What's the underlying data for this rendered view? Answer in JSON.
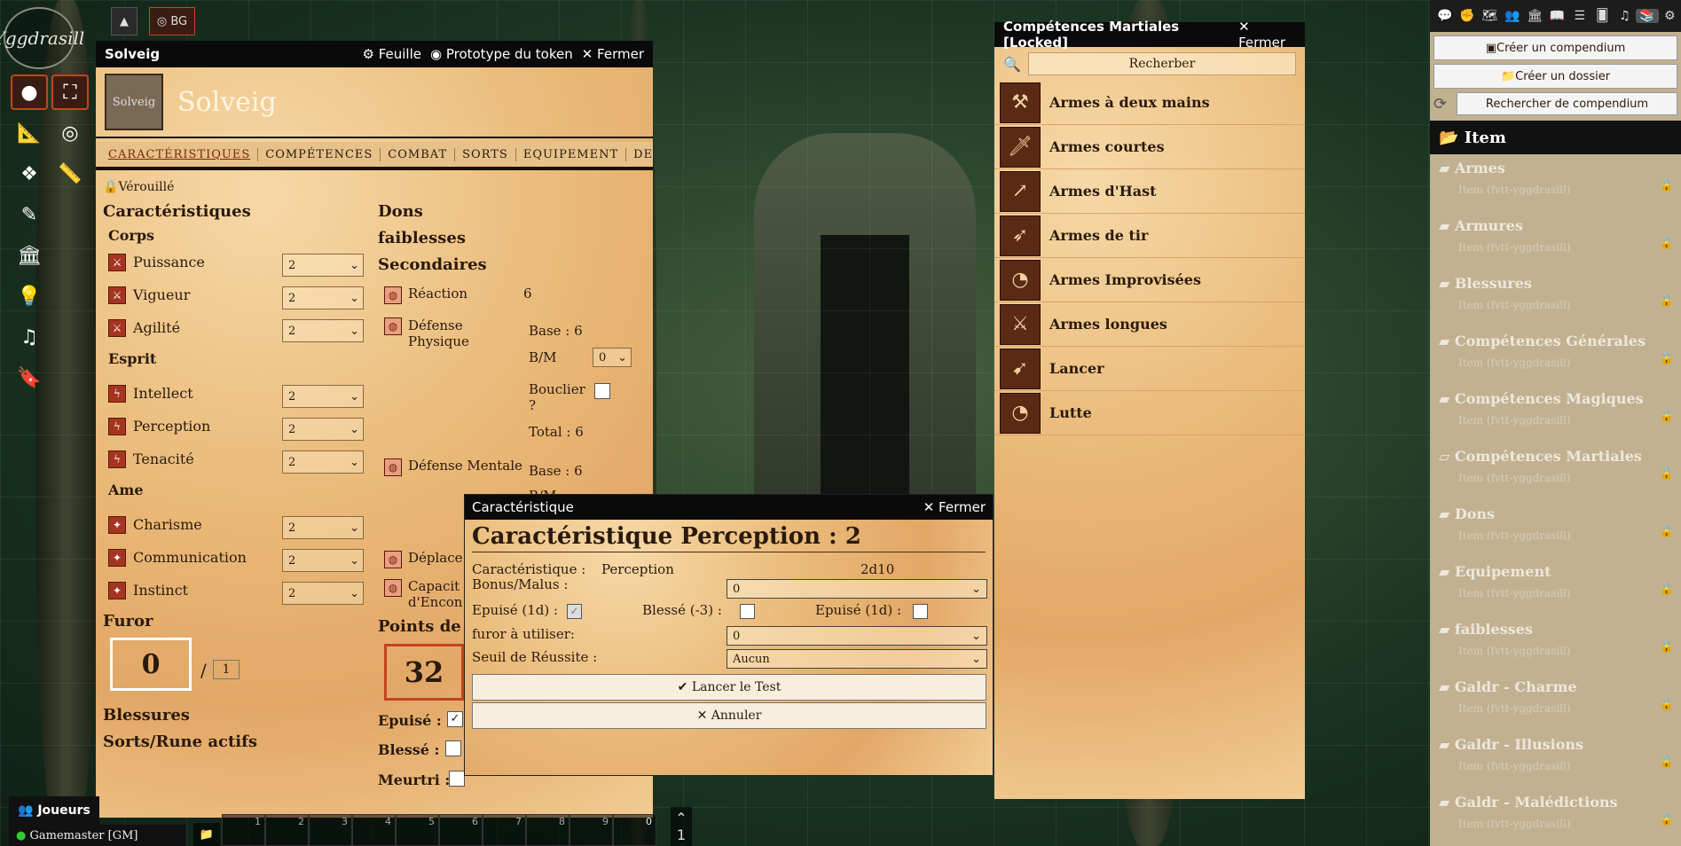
{
  "app": {
    "logo": "Yggdrasill",
    "bg_button": "BG"
  },
  "sheet": {
    "title": "Solveig",
    "actions": {
      "sheet": "Feuille",
      "token": "Prototype du token",
      "close": "Fermer"
    },
    "avatar_label": "Solveig",
    "name": "Solveig",
    "tabs": [
      "CARACTÉRISTIQUES",
      "COMPÉTENCES",
      "COMBAT",
      "SORTS",
      "EQUIPEMENT",
      "DESCRIPTION"
    ],
    "locked": "Vérouillé",
    "caracteristiques": "Caractéristiques",
    "corps": "Corps",
    "esprit": "Esprit",
    "ame": "Ame",
    "stats": {
      "puissance": {
        "label": "Puissance",
        "value": "2"
      },
      "vigueur": {
        "label": "Vigueur",
        "value": "2"
      },
      "agilite": {
        "label": "Agilité",
        "value": "2"
      },
      "intellect": {
        "label": "Intellect",
        "value": "2"
      },
      "perception": {
        "label": "Perception",
        "value": "2"
      },
      "tenacite": {
        "label": "Tenacité",
        "value": "2"
      },
      "charisme": {
        "label": "Charisme",
        "value": "2"
      },
      "communication": {
        "label": "Communication",
        "value": "2"
      },
      "instinct": {
        "label": "Instinct",
        "value": "2"
      }
    },
    "furor": {
      "label": "Furor",
      "value": "0",
      "separator": "/",
      "max": "1"
    },
    "blessures": "Blessures",
    "sorts_actifs": "Sorts/Rune actifs",
    "dons": "Dons",
    "faiblesses": "faiblesses",
    "secondaires": "Secondaires",
    "reaction": {
      "label": "Réaction",
      "value": "6"
    },
    "def_phys": {
      "label1": "Défense",
      "label2": "Physique",
      "base": "Base : 6",
      "bm_label": "B/M",
      "bm": "0",
      "bouclier1": "Bouclier",
      "bouclier2": "?",
      "total": "Total : 6"
    },
    "def_ment": {
      "label": "Défense Mentale",
      "base": "Base : 6",
      "bm_label": "B/M"
    },
    "deplacement": "Déplace",
    "capacite1": "Capacit",
    "capacite2": "d'Encon",
    "points_vie": "Points de V",
    "pv": "32",
    "epuise": "Epuisé :",
    "blesse": "Blessé :",
    "meurtri": "Meurtri :"
  },
  "dialog": {
    "window_title": "Caractéristique",
    "close": "Fermer",
    "heading": "Caractéristique Perception : 2",
    "carac_label": "Caractéristique :",
    "carac_value": "Perception",
    "dice": "2d10",
    "bonus_label": "Bonus/Malus :",
    "bonus_value": "0",
    "epuise1_label": "Epuisé (1d) :",
    "blesse_label": "Blessé (-3) :",
    "epuise2_label": "Epuisé (1d) :",
    "furor_label": "furor à utiliser:",
    "furor_value": "0",
    "seuil_label": "Seuil de Réussite :",
    "seuil_value": "Aucun",
    "roll": "Lancer le Test",
    "cancel": "Annuler"
  },
  "compendium": {
    "title": "Compétences Martiales [Locked]",
    "close": "Fermer",
    "search_placeholder": "Recherber",
    "items": [
      {
        "label": "Armes à deux mains",
        "icon": "axe-icon"
      },
      {
        "label": "Armes courtes",
        "icon": "dagger-icon"
      },
      {
        "label": "Armes d'Hast",
        "icon": "spear-icon"
      },
      {
        "label": "Armes de tir",
        "icon": "bow-icon"
      },
      {
        "label": "Armes Improvisées",
        "icon": "drum-icon"
      },
      {
        "label": "Armes longues",
        "icon": "sword-icon"
      },
      {
        "label": "Lancer",
        "icon": "javelin-icon"
      },
      {
        "label": "Lutte",
        "icon": "drum-icon"
      }
    ]
  },
  "sidebar": {
    "create_compendium": "Créer un compendium",
    "create_folder": "Créer un dossier",
    "search_placeholder": "Rechercher de compendium",
    "header": "Item",
    "folders": [
      {
        "name": "Armes",
        "sub": "Item (fvtt-yggdrasill)"
      },
      {
        "name": "Armures",
        "sub": "Item (fvtt-yggdrasill)"
      },
      {
        "name": "Blessures",
        "sub": "Item (fvtt-yggdrasill)"
      },
      {
        "name": "Compétences Générales",
        "sub": "Item (fvtt-yggdrasill)"
      },
      {
        "name": "Compétences Magiques",
        "sub": "Item (fvtt-yggdrasill)"
      },
      {
        "name": "Compétences Martiales",
        "sub": "Item (fvtt-yggdrasill)"
      },
      {
        "name": "Dons",
        "sub": "Item (fvtt-yggdrasill)"
      },
      {
        "name": "Equipement",
        "sub": "Item (fvtt-yggdrasill)"
      },
      {
        "name": "faiblesses",
        "sub": "Item (fvtt-yggdrasill)"
      },
      {
        "name": "Galdr - Charme",
        "sub": "Item (fvtt-yggdrasill)"
      },
      {
        "name": "Galdr - Illusions",
        "sub": "Item (fvtt-yggdrasill)"
      },
      {
        "name": "Galdr - Malédictions",
        "sub": "Item (fvtt-yggdrasill)"
      }
    ]
  },
  "players": {
    "title": "Joueurs",
    "gm": "Gamemaster [GM]"
  },
  "hotbar": {
    "slots": [
      "1",
      "2",
      "3",
      "4",
      "5",
      "6",
      "7",
      "8",
      "9",
      "0"
    ],
    "page": "1"
  }
}
